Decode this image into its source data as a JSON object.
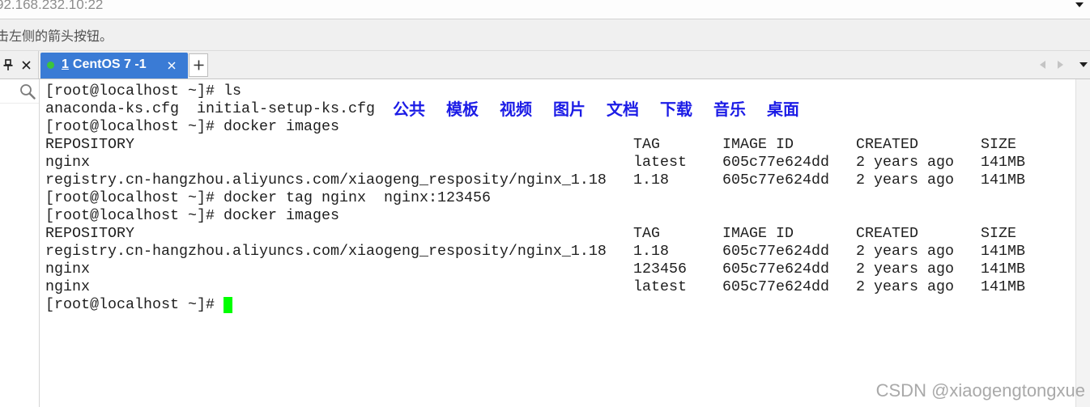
{
  "address_bar": {
    "address": "92.168.232.10:22",
    "dropdown_icon": "dropdown-arrow-icon"
  },
  "hint_bar": {
    "text": "击左侧的箭头按钮。"
  },
  "tab_bar": {
    "panel_icons": [
      "pin-icon",
      "close-icon"
    ],
    "tabs": [
      {
        "number": "1",
        "title": "CentOS 7 -1",
        "status_icon": "status-dot-icon",
        "close_icon": "tab-close-icon",
        "active": true
      }
    ],
    "new_tab_icon": "plus-icon",
    "nav_icons": [
      "scroll-left-icon",
      "scroll-right-icon",
      "tab-list-dropdown-icon"
    ]
  },
  "session_panel": {
    "search_icon": "search-icon"
  },
  "terminal": {
    "prompt": "[root@localhost ~]#",
    "commands": [
      "ls",
      "docker images",
      "docker tag nginx  nginx:123456",
      "docker images"
    ],
    "ls_output": {
      "files": [
        "anaconda-ks.cfg",
        "initial-setup-ks.cfg"
      ],
      "directories": [
        "公共",
        "模板",
        "视频",
        "图片",
        "文档",
        "下载",
        "音乐",
        "桌面"
      ]
    },
    "image_listings": [
      {
        "headers": [
          "REPOSITORY",
          "TAG",
          "IMAGE ID",
          "CREATED",
          "SIZE"
        ],
        "rows": [
          [
            "nginx",
            "latest",
            "605c77e624dd",
            "2 years ago",
            "141MB"
          ],
          [
            "registry.cn-hangzhou.aliyuncs.com/xiaogeng_resposity/nginx_1.18",
            "1.18",
            "605c77e624dd",
            "2 years ago",
            "141MB"
          ]
        ]
      },
      {
        "headers": [
          "REPOSITORY",
          "TAG",
          "IMAGE ID",
          "CREATED",
          "SIZE"
        ],
        "rows": [
          [
            "registry.cn-hangzhou.aliyuncs.com/xiaogeng_resposity/nginx_1.18",
            "1.18",
            "605c77e624dd",
            "2 years ago",
            "141MB"
          ],
          [
            "nginx",
            "123456",
            "605c77e624dd",
            "2 years ago",
            "141MB"
          ],
          [
            "nginx",
            "latest",
            "605c77e624dd",
            "2 years ago",
            "141MB"
          ]
        ]
      }
    ]
  },
  "watermark": "CSDN @xiaogengtongxue",
  "colors": {
    "tab_active_bg": "#3a7bd5",
    "status_dot": "#3cc43c",
    "terminal_text": "#1e1e1e",
    "directory_text": "#1c1ce6",
    "cursor": "#00ff00",
    "watermark": "#a9a9a9"
  }
}
